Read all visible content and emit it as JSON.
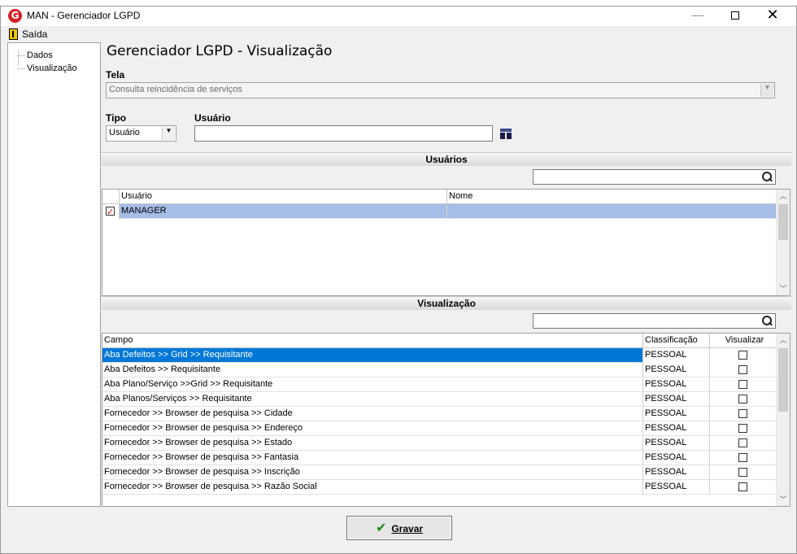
{
  "window": {
    "logo_letter": "G",
    "title": "MAN - Gerenciador LGPD",
    "min_glyph": "—",
    "close_glyph": "✕"
  },
  "menu": {
    "exit_label": "Saída"
  },
  "sidebar": {
    "items": [
      {
        "label": "Dados"
      },
      {
        "label": "Visualização"
      }
    ]
  },
  "main": {
    "title": "Gerenciador LGPD - Visualização",
    "screen_label": "Tela",
    "screen_value": "Consulta reincidência de serviços",
    "type_label": "Tipo",
    "type_value": "Usuário",
    "user_label": "Usuário",
    "user_value": ""
  },
  "users_section": {
    "header": "Usuários",
    "search_value": "",
    "columns": [
      "Usuário",
      "Nome"
    ],
    "rows": [
      {
        "checked": true,
        "usuario": "MANAGER",
        "nome": ""
      }
    ]
  },
  "view_section": {
    "header": "Visualização",
    "search_value": "",
    "columns": [
      "Campo",
      "Classificação",
      "Visualizar"
    ],
    "rows": [
      {
        "campo": "Aba Defeitos >> Grid >> Requisitante",
        "classificacao": "PESSOAL",
        "visualizar": false
      },
      {
        "campo": "Aba Defeitos >> Requisitante",
        "classificacao": "PESSOAL",
        "visualizar": false
      },
      {
        "campo": "Aba Plano/Serviço >>Grid >> Requisitante",
        "classificacao": "PESSOAL",
        "visualizar": false
      },
      {
        "campo": "Aba Planos/Serviços >> Requisitante",
        "classificacao": "PESSOAL",
        "visualizar": false
      },
      {
        "campo": "Fornecedor >> Browser de pesquisa >> Cidade",
        "classificacao": "PESSOAL",
        "visualizar": false
      },
      {
        "campo": "Fornecedor >> Browser de pesquisa >> Endereço",
        "classificacao": "PESSOAL",
        "visualizar": false
      },
      {
        "campo": "Fornecedor >> Browser de pesquisa >> Estado",
        "classificacao": "PESSOAL",
        "visualizar": false
      },
      {
        "campo": "Fornecedor >> Browser de pesquisa >> Fantasia",
        "classificacao": "PESSOAL",
        "visualizar": false
      },
      {
        "campo": "Fornecedor >> Browser de pesquisa >> Inscrição",
        "classificacao": "PESSOAL",
        "visualizar": false
      },
      {
        "campo": "Fornecedor >> Browser de pesquisa >> Razão Social",
        "classificacao": "PESSOAL",
        "visualizar": false
      }
    ]
  },
  "footer": {
    "save_label": "Gravar"
  },
  "colors": {
    "selection": "#0078d7",
    "highlight_row": "#a6bde8",
    "accent_logo": "#d42027"
  }
}
